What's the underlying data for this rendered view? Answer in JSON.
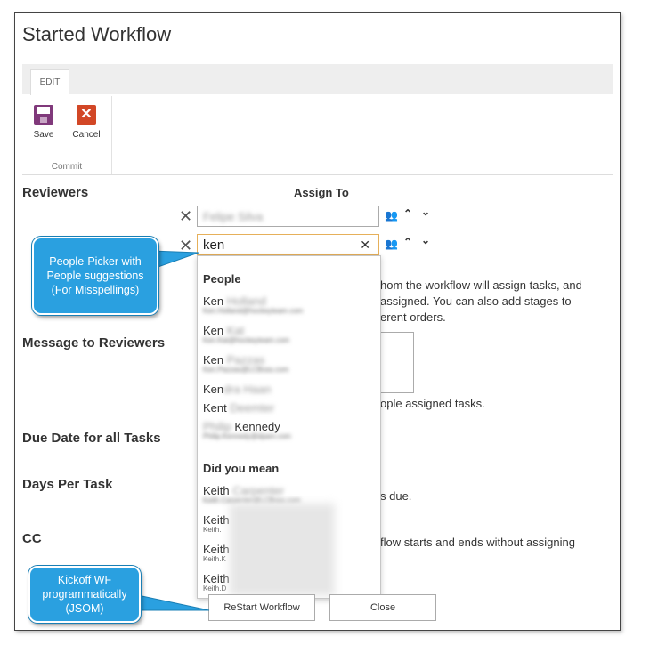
{
  "page": {
    "title": "Started Workflow"
  },
  "ribbon": {
    "tab_edit": "EDIT",
    "save_label": "Save",
    "cancel_label": "Cancel",
    "group_label": "Commit"
  },
  "form": {
    "reviewers_label": "Reviewers",
    "assign_to_label": "Assign To",
    "reviewer1_value": "Felipe Silva",
    "reviewer2_value": "ken",
    "reviewers_help_1": "hom the workflow will assign tasks, and",
    "reviewers_help_2": "assigned. You can also add stages to",
    "reviewers_help_3": "erent orders.",
    "message_label": "Message to Reviewers",
    "message_help": "ople assigned tasks.",
    "due_date_label": "Due Date for all Tasks",
    "days_per_task_label": "Days Per Task",
    "days_help": "s due.",
    "cc_label": "CC",
    "cc_help": "flow starts and ends without assigning"
  },
  "suggestions": {
    "people_header": "People",
    "did_you_mean_header": "Did you mean",
    "people": [
      {
        "first": "Ken",
        "rest": "Holland",
        "email": "Ken.Holland@hockeyteam.com"
      },
      {
        "first": "Ken",
        "rest": "Kat",
        "email": "Ken.Kat@hockeyteam.com"
      },
      {
        "first": "Ken",
        "rest": "Pazzas",
        "email": "Ken.Pazzas@LCBoss.com"
      },
      {
        "first": "Ken",
        "rest": "dra Haan",
        "email": ""
      },
      {
        "first": "Kent",
        "rest": "Deemter",
        "email": ""
      },
      {
        "first": "Kennedy",
        "rest": "Philip",
        "email": "Philip.Kennedy@dpam.com"
      }
    ],
    "did_you_mean": [
      {
        "first": "Keith",
        "rest": "Carpenter",
        "email": "Keith.Carpenter@LCBoss.com"
      },
      {
        "first": "Keith",
        "rest": "",
        "email": "Keith."
      },
      {
        "first": "Keith",
        "rest": "",
        "email": "Keith.K"
      },
      {
        "first": "Keith",
        "rest": "",
        "email": "Keith.D"
      }
    ]
  },
  "actions": {
    "restart_label": "ReStart Workflow",
    "close_label": "Close"
  },
  "callouts": {
    "people_picker": "People-Picker with People suggestions (For Misspellings)",
    "kickoff": "Kickoff WF programmatically (JSOM)"
  },
  "colors": {
    "callout": "#2aa0e0",
    "save_icon": "#80397b",
    "cancel_icon": "#d24726",
    "active_border": "#e6b05a"
  }
}
